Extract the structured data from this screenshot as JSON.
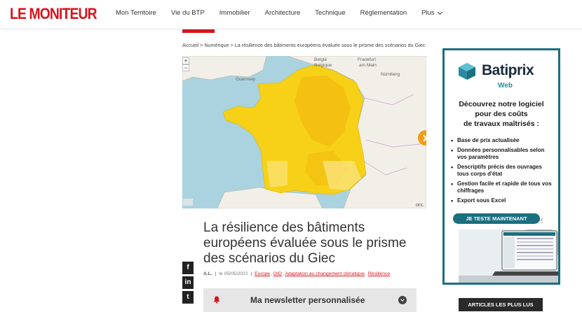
{
  "header": {
    "logo": "LE MONITEUR",
    "nav": [
      "Mon Territoire",
      "Vie du BTP",
      "Immobilier",
      "Architecture",
      "Technique",
      "Réglementation",
      "Plus"
    ]
  },
  "breadcrumb": "Accueil > Numérique > La résilience des bâtiments européens évaluée sous le prisme des scénarios du Giec",
  "map": {
    "zoom_in": "+",
    "zoom_out": "−",
    "labels": {
      "belgie": "België",
      "belgique": "Belgique",
      "frankfurt": "Frankfurt",
      "am_main": "am Main",
      "nurnberg": "Nürnberg",
      "guernsey": "Guernsey"
    },
    "attribution": "ors."
  },
  "article": {
    "title": "La résilience des bâtiments européens évaluée sous le prisme des scénarios du Giec",
    "author": "A.L.",
    "date": "le 05/05/2022",
    "tags": [
      "Europe",
      "OID",
      "Adaptation au changement climatique",
      "Résilience"
    ]
  },
  "social": {
    "facebook": "f",
    "linkedin": "in",
    "twitter": "t"
  },
  "newsletter": {
    "label": "Ma newsletter personnalisée"
  },
  "ad": {
    "brand": "Batiprix",
    "sub": "Web",
    "headline_1": "Découvrez notre logiciel",
    "headline_2": "pour des coûts",
    "headline_3": "de travaux maîtrisés :",
    "bullets": [
      "Base de prix actualisée",
      "Données personnalisables selon vos paramètres",
      "Descriptifs précis des ouvrages tous corps d'état",
      "Gestion facile et rapide de tous vos chiffrages",
      "Export sous Excel"
    ],
    "cta": "JE TESTE MAINTENANT",
    "colors": {
      "accent": "#1b6f7f",
      "web": "#2a8ba0"
    }
  },
  "sidebar": {
    "most_read": "ARTICLES LES PLUS LUS"
  },
  "colors": {
    "brand": "#d7141d",
    "map_sea": "#aad3df",
    "map_heat": "#f7d117"
  }
}
